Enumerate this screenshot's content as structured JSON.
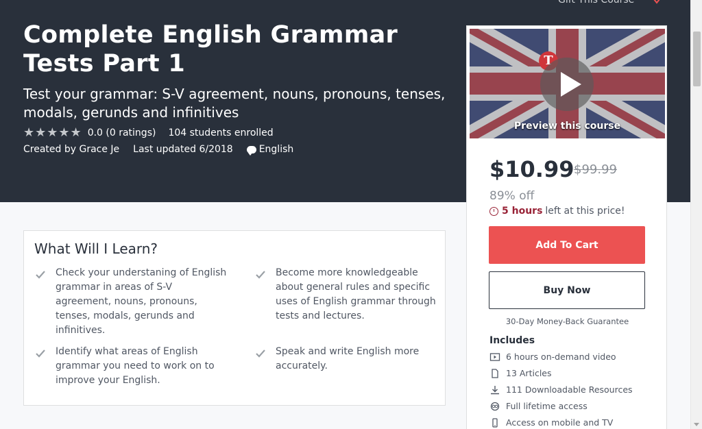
{
  "header": {
    "gift_label": "Gift This Course",
    "title": "Complete English Grammar Tests Part 1",
    "subtitle": "Test your grammar: S-V agreement, nouns, pronouns, tenses, modals, gerunds and infinitives",
    "stars": "★★★★★",
    "rating_value": 0.0,
    "rating_text": "0.0 (0 ratings)",
    "enrolled_text": "104 students enrolled",
    "created_by": "Created by Grace Je",
    "last_updated": "Last updated 6/2018",
    "language": "English"
  },
  "learn": {
    "title": "What Will I Learn?",
    "items": [
      "Check your understaning of English grammar in areas of S-V agreement, nouns, pronouns, tenses, modals, gerunds and infinitives.",
      "Become more knowledgeable about general rules and specific uses of English grammar through tests and lectures.",
      "Identify what areas of English grammar you need to work on to improve your English.",
      "Speak and write English more accurately."
    ]
  },
  "sidebar": {
    "preview_label": "Preview this course",
    "logo_letter": "T",
    "price": "$10.99",
    "old_price": "$99.99",
    "discount": "89% off",
    "timer_hours": "5 hours",
    "timer_rest": "left at this price!",
    "add_to_cart": "Add To Cart",
    "buy_now": "Buy Now",
    "guarantee": "30-Day Money-Back Guarantee",
    "includes_title": "Includes",
    "includes": [
      {
        "icon": "video-icon",
        "label": "6 hours on-demand video"
      },
      {
        "icon": "file-icon",
        "label": "13 Articles"
      },
      {
        "icon": "download-icon",
        "label": "111 Downloadable Resources"
      },
      {
        "icon": "infinity-icon",
        "label": "Full lifetime access"
      },
      {
        "icon": "mobile-icon",
        "label": "Access on mobile and TV"
      }
    ]
  },
  "colors": {
    "hero_bg": "#29303b",
    "accent_red": "#ec5252",
    "timer_red": "#992337"
  }
}
